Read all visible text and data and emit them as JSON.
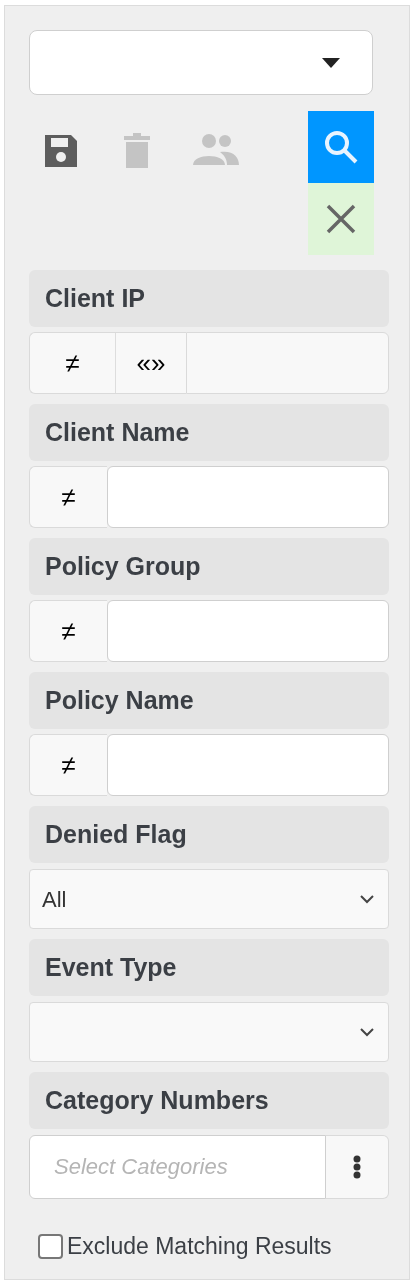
{
  "toolbar": [
    {
      "kind": "save",
      "disabled": false
    },
    {
      "kind": "delete",
      "disabled": true
    },
    {
      "kind": "share",
      "disabled": true
    }
  ],
  "actions": [
    {
      "kind": "search"
    },
    {
      "kind": "clear"
    }
  ],
  "filters": [
    {
      "label": "Client IP",
      "kind": "text",
      "operators": [
        "≠",
        "«»"
      ]
    },
    {
      "label": "Client Name",
      "kind": "text",
      "operators": [
        "≠"
      ]
    },
    {
      "label": "Policy Group",
      "kind": "text",
      "operators": [
        "≠"
      ]
    },
    {
      "label": "Policy Name",
      "kind": "text",
      "operators": [
        "≠"
      ]
    },
    {
      "label": "Denied Flag",
      "kind": "select",
      "value": "All"
    },
    {
      "label": "Event Type",
      "kind": "select"
    },
    {
      "label": "Category Numbers",
      "kind": "multiselect",
      "placeholder": "Select Categories"
    }
  ],
  "exclude_option": {
    "label": "Exclude Matching Results",
    "checked": false
  }
}
